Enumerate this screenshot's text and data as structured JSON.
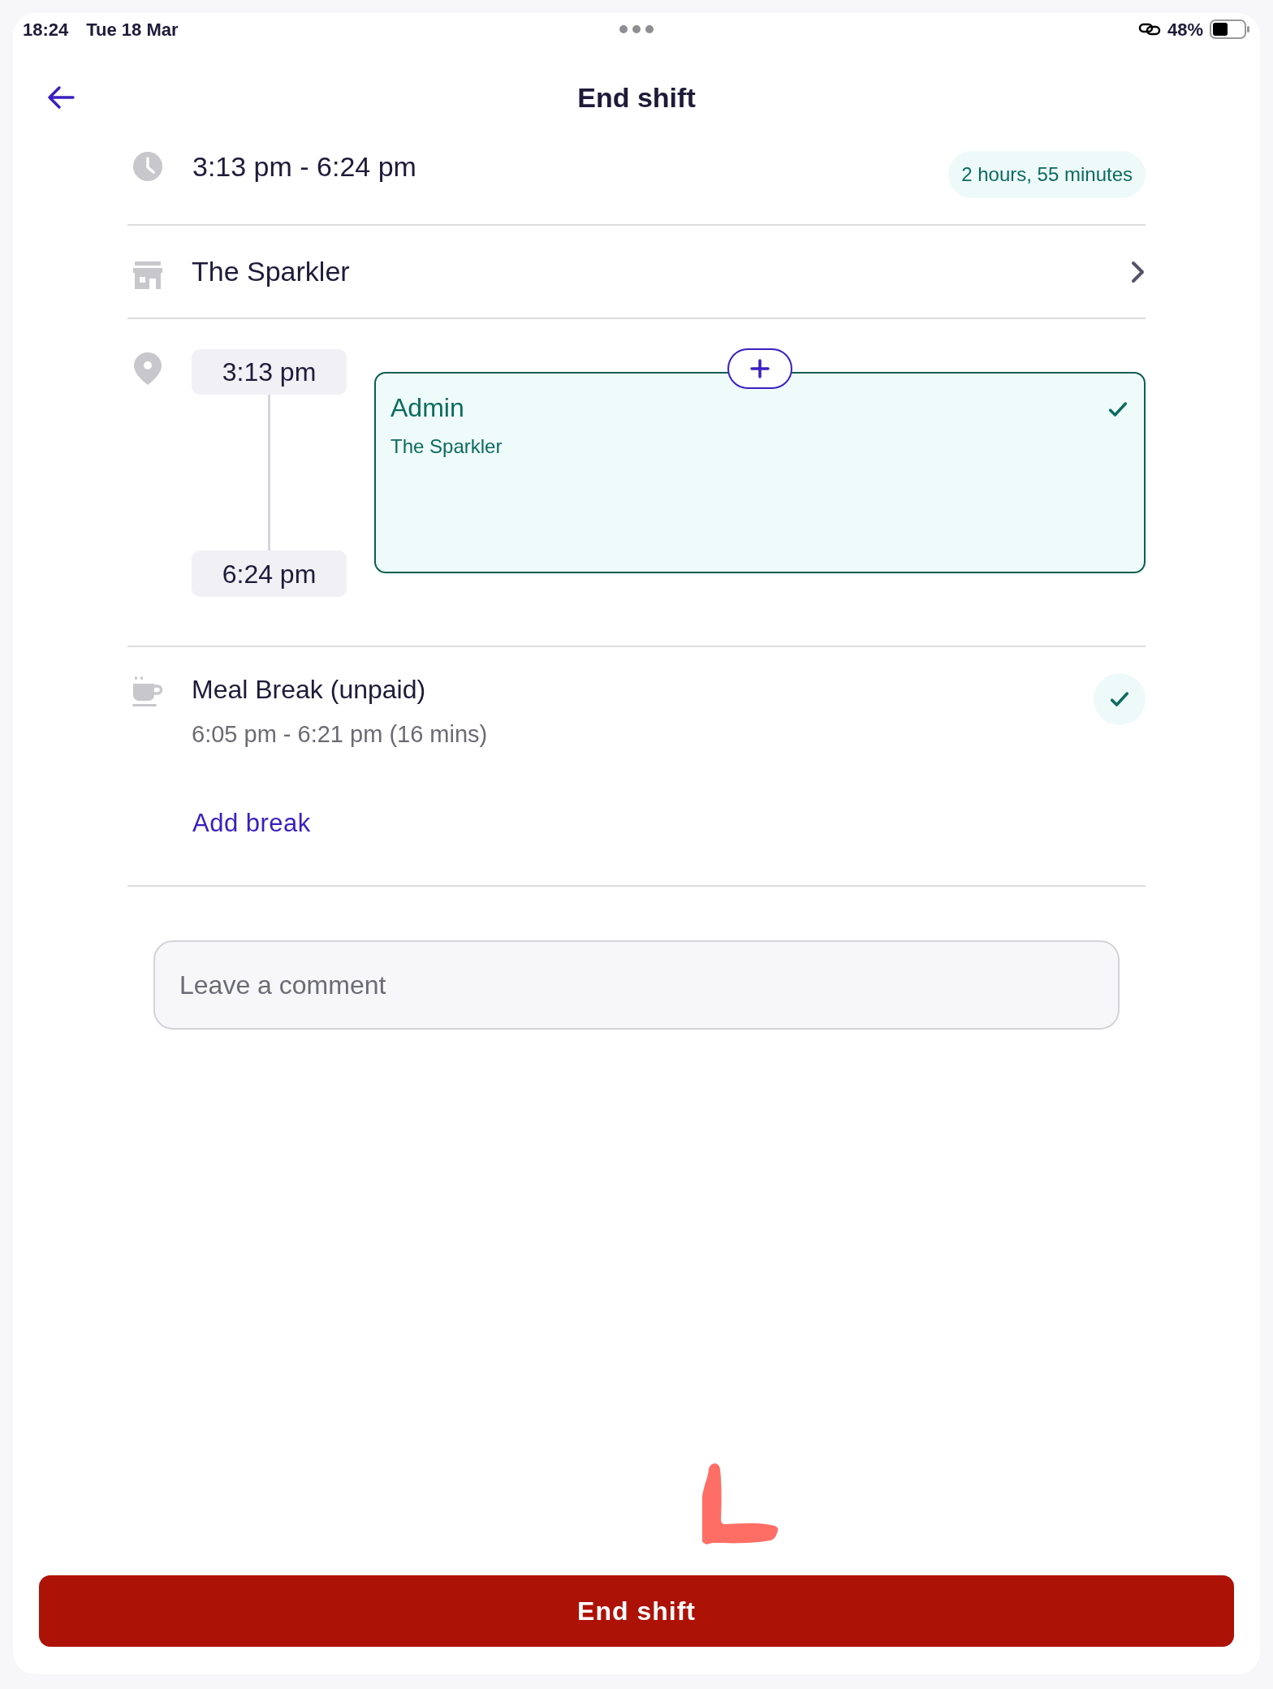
{
  "status_bar": {
    "time": "18:24",
    "date": "Tue 18 Mar",
    "battery": "48%"
  },
  "header": {
    "title": "End shift"
  },
  "shift_time": {
    "range": "3:13 pm - 6:24 pm",
    "duration": "2 hours, 55 minutes"
  },
  "location": {
    "name": "The Sparkler"
  },
  "timeline": {
    "start": "3:13 pm",
    "end": "6:24 pm",
    "activities": [
      {
        "title": "Admin",
        "location": "The Sparkler",
        "selected": true
      }
    ]
  },
  "breaks": [
    {
      "title": "Meal Break (unpaid)",
      "detail": "6:05 pm - 6:21 pm (16 mins)",
      "confirmed": true
    }
  ],
  "add_break": "Add break",
  "comment": {
    "placeholder": "Leave a comment"
  },
  "primary_button": "End shift"
}
